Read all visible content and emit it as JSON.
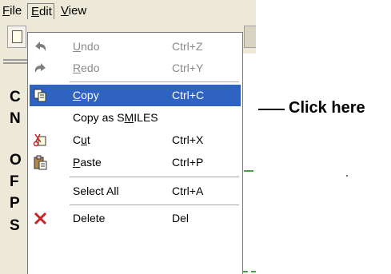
{
  "menubar": {
    "file": {
      "label": "File",
      "mnemonic": "F",
      "rest": "ile"
    },
    "edit": {
      "label": "Edit",
      "mnemonic": "E",
      "rest": "dit"
    },
    "view": {
      "label": "View",
      "mnemonic": "V",
      "rest": "iew"
    }
  },
  "atoms": [
    "C",
    "N",
    "O",
    "F",
    "P",
    "S"
  ],
  "edit_menu": {
    "items": [
      {
        "label": "Undo",
        "mnemonic": "U",
        "rest": "ndo",
        "shortcut": "Ctrl+Z",
        "icon": "undo-icon",
        "state": "disabled"
      },
      {
        "label": "Redo",
        "mnemonic": "R",
        "rest": "edo",
        "shortcut": "Ctrl+Y",
        "icon": "redo-icon",
        "state": "disabled"
      },
      {
        "label": "Copy",
        "mnemonic": "C",
        "rest": "opy",
        "shortcut": "Ctrl+C",
        "icon": "copy-icon",
        "state": "selected"
      },
      {
        "label": "Copy as SMILES",
        "pre": "Copy as S",
        "mnemonic": "M",
        "rest": "ILES",
        "shortcut": "",
        "icon": "",
        "state": "normal"
      },
      {
        "label": "Cut",
        "pre": "C",
        "mnemonic": "u",
        "rest": "t",
        "shortcut": "Ctrl+X",
        "icon": "cut-icon",
        "state": "normal"
      },
      {
        "label": "Paste",
        "mnemonic": "P",
        "rest": "aste",
        "shortcut": "Ctrl+P",
        "icon": "paste-icon",
        "state": "normal"
      },
      {
        "label": "Select All",
        "shortcut": "Ctrl+A",
        "icon": "",
        "state": "normal"
      },
      {
        "label": "Delete",
        "shortcut": "Del",
        "icon": "delete-icon",
        "state": "normal"
      }
    ]
  },
  "annotation": {
    "text": "Click here"
  },
  "colors": {
    "highlight": "#2f63c2",
    "menu_bg": "#ffffff",
    "chrome": "#ece9d8",
    "delete_red": "#cc2020"
  }
}
